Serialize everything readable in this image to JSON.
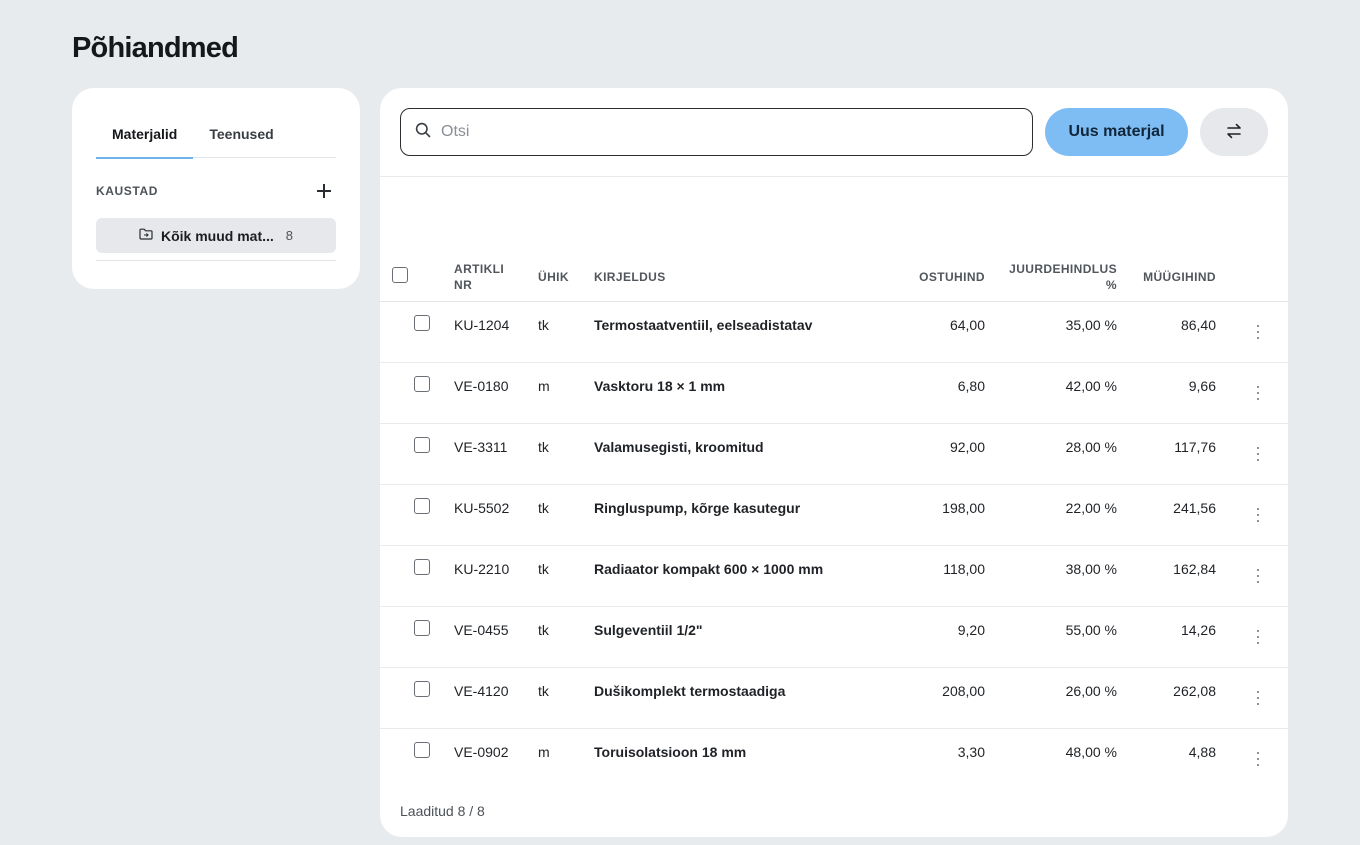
{
  "page": {
    "title": "Põhiandmed"
  },
  "sidebar": {
    "tabs": [
      {
        "label": "Materjalid",
        "active": true
      },
      {
        "label": "Teenused",
        "active": false
      }
    ],
    "folders_title": "KAUSTAD",
    "folders": [
      {
        "label": "Kõik muud mat...",
        "count": "8",
        "icon": "folder-icon"
      }
    ]
  },
  "toolbar": {
    "search_placeholder": "Otsi",
    "new_button": "Uus materjal",
    "swap_icon": "swap-arrows-icon"
  },
  "table": {
    "columns": {
      "article": "ARTIKLI NR",
      "unit": "ÜHIK",
      "description": "KIRJELDUS",
      "purchase": "OSTUHIND",
      "markup": "JUURDEHINDLUS %",
      "sale": "MÜÜGIHIND"
    },
    "rows": [
      {
        "article": "KU-1204",
        "unit": "tk",
        "description": "Termostaatventiil, eelseadistatav",
        "purchase": "64,00",
        "markup": "35,00 %",
        "sale": "86,40"
      },
      {
        "article": "VE-0180",
        "unit": "m",
        "description": "Vasktoru 18 × 1 mm",
        "purchase": "6,80",
        "markup": "42,00 %",
        "sale": "9,66"
      },
      {
        "article": "VE-3311",
        "unit": "tk",
        "description": "Valamusegisti, kroomitud",
        "purchase": "92,00",
        "markup": "28,00 %",
        "sale": "117,76"
      },
      {
        "article": "KU-5502",
        "unit": "tk",
        "description": "Ringluspump, kõrge kasutegur",
        "purchase": "198,00",
        "markup": "22,00 %",
        "sale": "241,56"
      },
      {
        "article": "KU-2210",
        "unit": "tk",
        "description": "Radiaator kompakt 600 × 1000 mm",
        "purchase": "118,00",
        "markup": "38,00 %",
        "sale": "162,84"
      },
      {
        "article": "VE-0455",
        "unit": "tk",
        "description": "Sulgeventiil 1/2\"",
        "purchase": "9,20",
        "markup": "55,00 %",
        "sale": "14,26"
      },
      {
        "article": "VE-4120",
        "unit": "tk",
        "description": "Dušikomplekt termostaadiga",
        "purchase": "208,00",
        "markup": "26,00 %",
        "sale": "262,08"
      },
      {
        "article": "VE-0902",
        "unit": "m",
        "description": "Toruisolatsioon 18 mm",
        "purchase": "3,30",
        "markup": "48,00 %",
        "sale": "4,88"
      }
    ]
  },
  "footer": {
    "status": "Laaditud 8 / 8"
  },
  "colors": {
    "accent": "#7dbdf3",
    "tab_underline": "#6fb3ec",
    "background": "#e8ebee"
  }
}
